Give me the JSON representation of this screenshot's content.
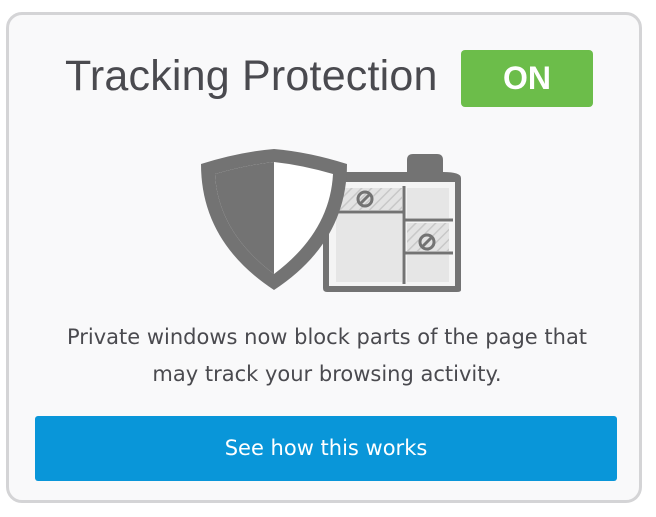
{
  "panel": {
    "title": "Tracking Protection",
    "status_badge": "ON",
    "description_line1": "Private windows now block parts of the page that",
    "description_line2": "may track your browsing activity.",
    "cta_label": "See how this works",
    "illustration_icon": "shield-and-blocked-page-icon"
  },
  "colors": {
    "badge": "#6cbd4a",
    "button": "#0996d9",
    "text": "#4a4a4f",
    "icon": "#737373"
  }
}
